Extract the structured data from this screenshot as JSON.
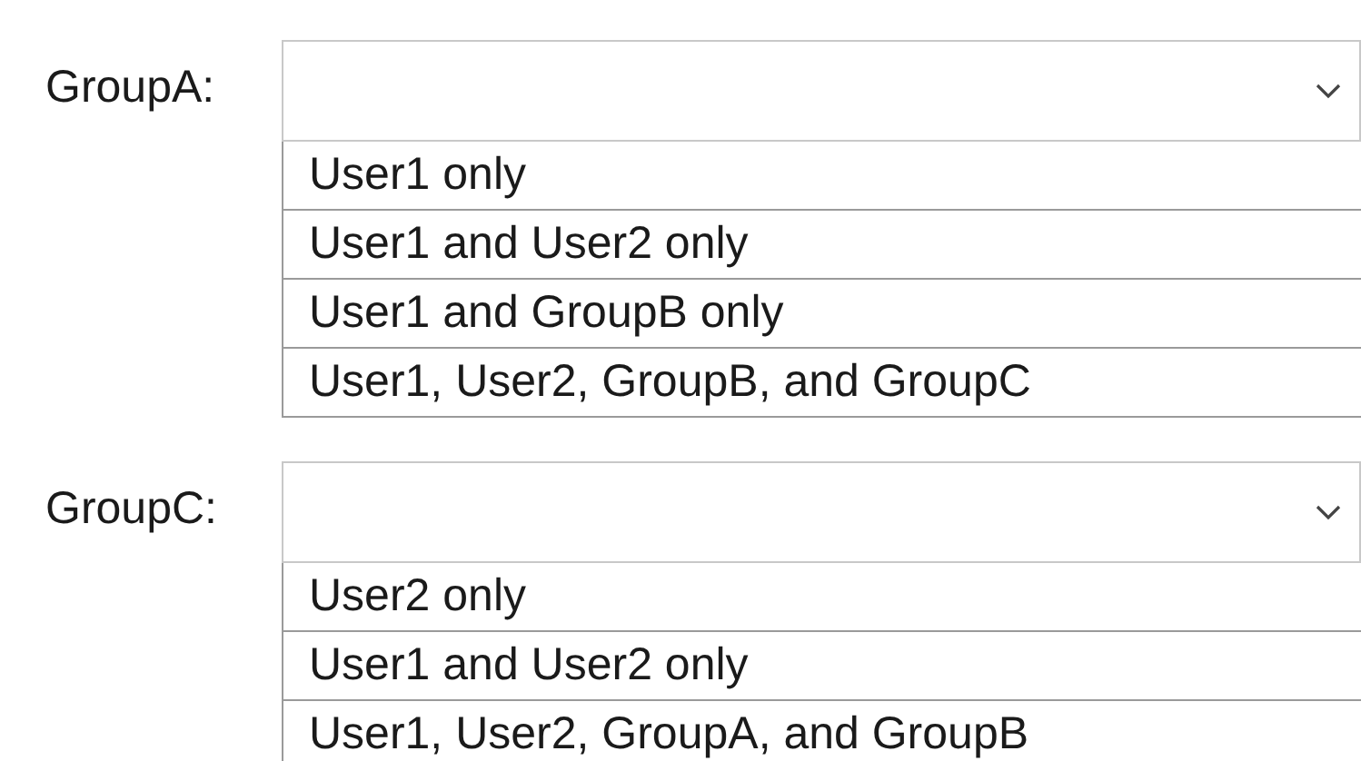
{
  "groups": [
    {
      "label": "GroupA:",
      "options": [
        "User1 only",
        "User1 and User2 only",
        "User1 and GroupB only",
        "User1, User2, GroupB, and GroupC"
      ]
    },
    {
      "label": "GroupC:",
      "options": [
        "User2 only",
        "User1 and User2 only",
        "User1, User2, GroupA, and GroupB"
      ]
    }
  ]
}
